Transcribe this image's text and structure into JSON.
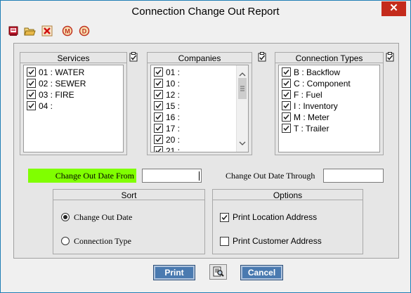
{
  "window": {
    "title": "Connection Change Out Report",
    "close_label": "✕"
  },
  "toolbar": {
    "icons": [
      "report-icon",
      "open-folder-icon",
      "cancel-x-icon",
      "m-circle-icon",
      "d-circle-icon"
    ],
    "m_label": "M",
    "d_label": "D"
  },
  "services": {
    "title": "Services",
    "items": [
      {
        "label": "01 : WATER",
        "checked": true
      },
      {
        "label": "02 : SEWER",
        "checked": true
      },
      {
        "label": "03 : FIRE",
        "checked": true
      },
      {
        "label": "04 :",
        "checked": true
      }
    ]
  },
  "companies": {
    "title": "Companies",
    "items": [
      {
        "label": "01 :",
        "checked": true
      },
      {
        "label": "10 :",
        "checked": true
      },
      {
        "label": "12 :",
        "checked": true
      },
      {
        "label": "15 :",
        "checked": true
      },
      {
        "label": "16 :",
        "checked": true
      },
      {
        "label": "17 :",
        "checked": true
      },
      {
        "label": "20 :",
        "checked": true
      },
      {
        "label": "21 :",
        "checked": true
      }
    ]
  },
  "connection_types": {
    "title": "Connection Types",
    "items": [
      {
        "label": "B : Backflow",
        "checked": true
      },
      {
        "label": "C : Component",
        "checked": true
      },
      {
        "label": "F : Fuel",
        "checked": true
      },
      {
        "label": "I : Inventory",
        "checked": true
      },
      {
        "label": "M : Meter",
        "checked": true
      },
      {
        "label": "T : Trailer",
        "checked": true
      }
    ]
  },
  "dates": {
    "from_label": "Change Out Date From",
    "from_value": "",
    "through_label": "Change Out Date Through",
    "through_value": ""
  },
  "sort": {
    "title": "Sort",
    "options": [
      {
        "label": "Change Out Date",
        "selected": true
      },
      {
        "label": "Connection Type",
        "selected": false
      }
    ]
  },
  "options": {
    "title": "Options",
    "items": [
      {
        "label": "Print Location Address",
        "checked": true
      },
      {
        "label": "Print Customer Address",
        "checked": false
      }
    ]
  },
  "buttons": {
    "print": "Print",
    "cancel": "Cancel"
  },
  "colors": {
    "date_from_highlight": "#80ff00",
    "button_bg": "#4a7ab0"
  }
}
